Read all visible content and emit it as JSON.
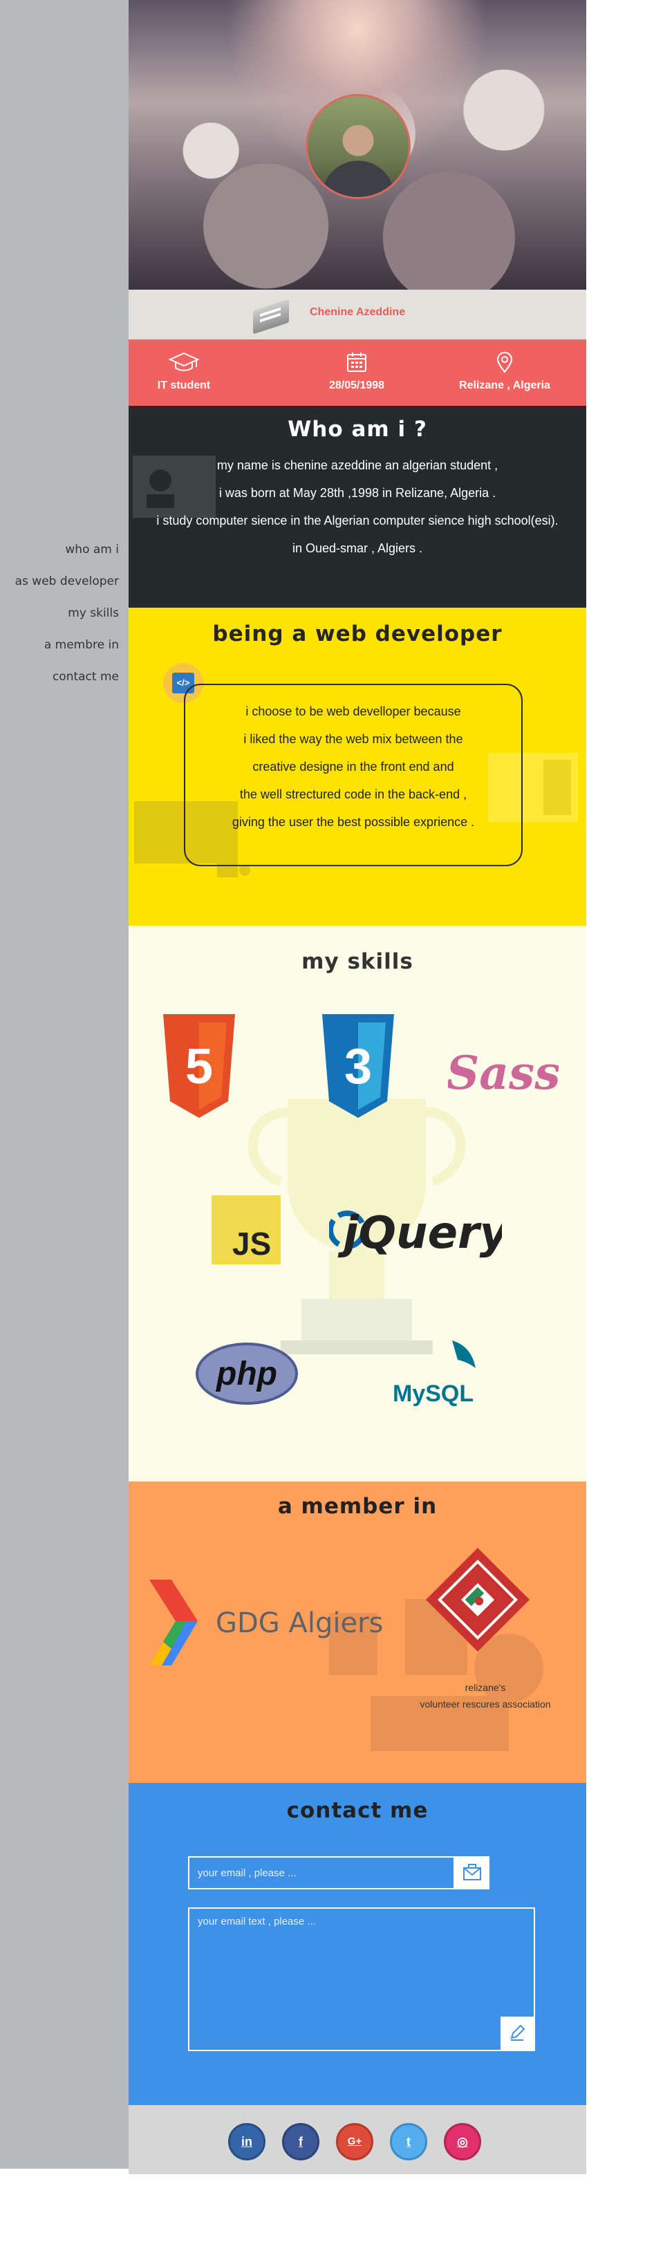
{
  "sidebar": {
    "nav": [
      "who am i",
      "as web developer",
      "my skills",
      "a membre in",
      "contact me"
    ]
  },
  "header": {
    "name": "Chenine Azeddine"
  },
  "info": {
    "study": "IT student",
    "birthdate": "28/05/1998",
    "location": "Relizane , Algeria"
  },
  "who": {
    "title": "Who am i ?",
    "lines": [
      "my name is chenine azeddine an algerian student ,",
      "i was born at May 28th ,1998 in Relizane, Algeria .",
      "i study  computer sience in the Algerian computer sience high school(esi).",
      "in Oued-smar , Algiers ."
    ]
  },
  "developer": {
    "title": "being a web developer",
    "lines": [
      "i choose to be web develloper because",
      "i liked the way the web mix between the",
      "creative designe in the front end and",
      "the well strectured code in the back-end ,",
      "giving the user the best possible exprience ."
    ],
    "icon_label": "</>"
  },
  "skills": {
    "title": "my skills",
    "items": [
      "5",
      "3",
      "Sass",
      "JS",
      "jQuery",
      "php",
      "MySQL"
    ]
  },
  "member": {
    "title": "a member in",
    "gdg": "GDG Algiers",
    "association_line1": "relizane's",
    "association_line2": "volunteer rescures association"
  },
  "contact": {
    "title": "contact me",
    "email_placeholder": "your email , please ...",
    "text_placeholder": "your email text , please ..."
  },
  "social": {
    "linkedin": "in",
    "facebook": "f",
    "googleplus": "G+",
    "twitter": "t",
    "instagram": "◎"
  },
  "colors": {
    "accent_red": "#f0625f",
    "dark": "#232b2c",
    "yellow": "#ffe300",
    "cream": "#fbfde9",
    "orange": "#fe9f5b",
    "blue": "#3d91e6"
  }
}
